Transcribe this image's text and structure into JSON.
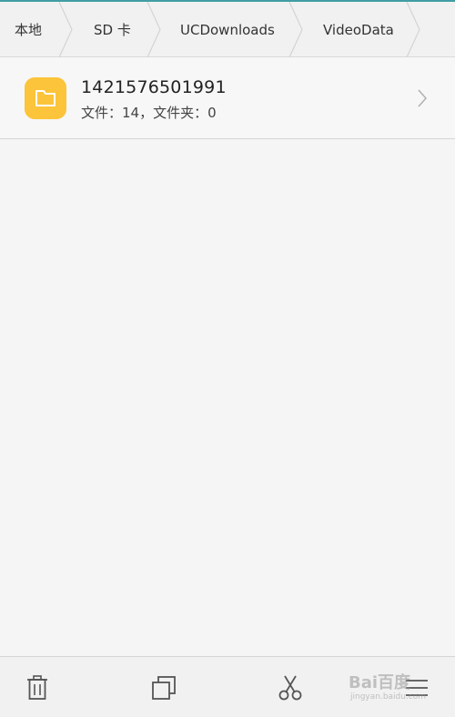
{
  "breadcrumb": {
    "items": [
      {
        "label": "本地"
      },
      {
        "label": "SD 卡"
      },
      {
        "label": "UCDownloads"
      },
      {
        "label": "VideoData"
      }
    ]
  },
  "list": {
    "items": [
      {
        "name": "1421576501991",
        "subtitle": "文件：14，文件夹：0",
        "icon": "folder-icon"
      }
    ]
  },
  "toolbar": {
    "buttons": [
      {
        "icon": "trash-icon"
      },
      {
        "icon": "copy-icon"
      },
      {
        "icon": "scissors-icon"
      },
      {
        "icon": "menu-icon"
      }
    ]
  },
  "watermark": {
    "main": "Bai百度",
    "sub": "jingyan.baidu.com"
  },
  "colors": {
    "accent_line": "#3f9ea3",
    "folder_icon": "#fbc43a",
    "background": "#f5f5f5"
  }
}
